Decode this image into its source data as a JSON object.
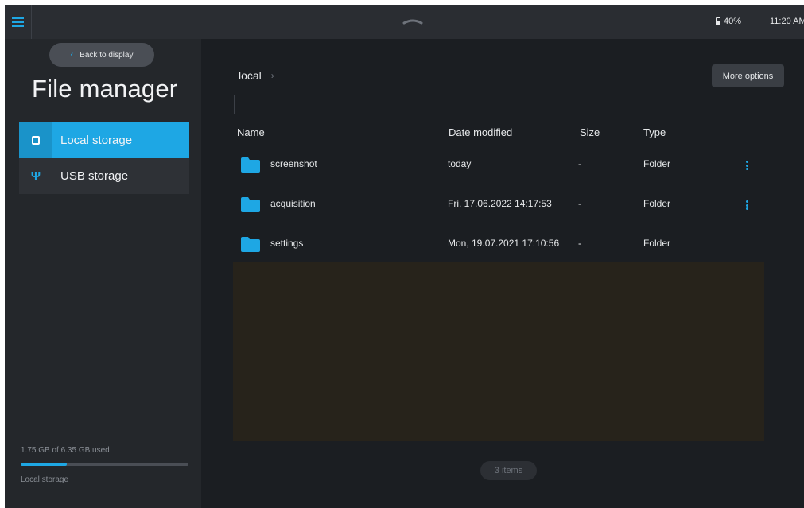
{
  "topbar": {
    "battery": "40%",
    "time": "11:20 AM"
  },
  "sidebar": {
    "back_label": "Back to display",
    "title": "File manager",
    "items": [
      {
        "label": "Local storage",
        "icon": "tablet-icon",
        "active": true
      },
      {
        "label": "USB storage",
        "icon": "usb-icon",
        "active": false
      }
    ],
    "storage_used_text": "1.75 GB of 6.35 GB used",
    "storage_used_fraction": 0.276,
    "storage_label": "Local storage"
  },
  "main": {
    "breadcrumb": [
      "local"
    ],
    "more_options_label": "More options",
    "columns": {
      "name": "Name",
      "date": "Date modified",
      "size": "Size",
      "type": "Type"
    },
    "rows": [
      {
        "name": "screenshot",
        "date": "today",
        "size": "-",
        "type": "Folder",
        "menu": true
      },
      {
        "name": "acquisition",
        "date": "Fri, 17.06.2022 14:17:53",
        "size": "-",
        "type": "Folder",
        "menu": true
      },
      {
        "name": "settings",
        "date": "Mon, 19.07.2021 17:10:56",
        "size": "-",
        "type": "Folder",
        "menu": false
      }
    ],
    "item_count_label": "3 items"
  },
  "colors": {
    "accent": "#1ea7e4",
    "sidebar_bg": "#24272b",
    "main_bg": "#1b1e22",
    "topbar_bg": "#2a2d32"
  }
}
